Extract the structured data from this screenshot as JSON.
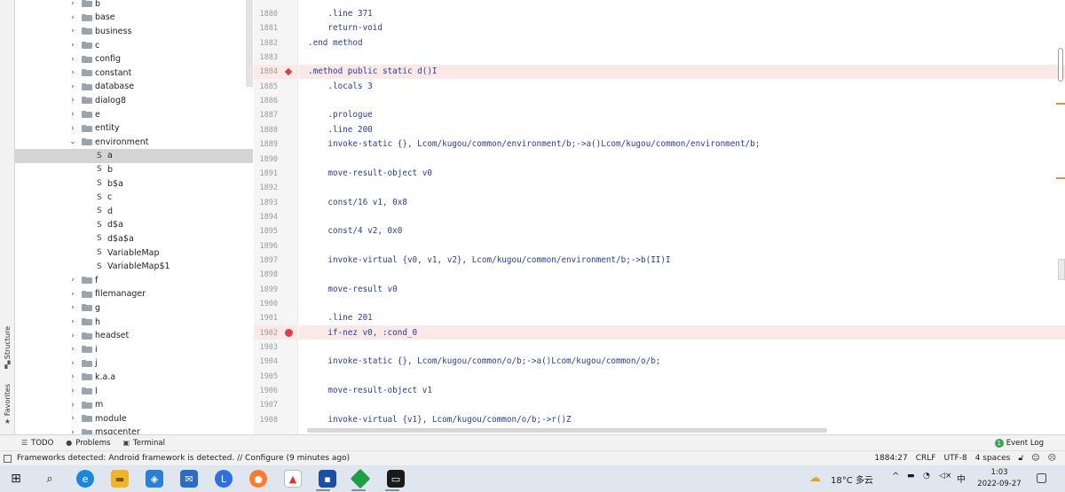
{
  "tool_strip": {
    "structure_label": "Structure",
    "favorites_label": "Favorites"
  },
  "tree": {
    "items": [
      {
        "type": "pkg",
        "label": "b",
        "expanded": false
      },
      {
        "type": "pkg",
        "label": "base",
        "expanded": false
      },
      {
        "type": "pkg",
        "label": "business",
        "expanded": false
      },
      {
        "type": "pkg",
        "label": "c",
        "expanded": false
      },
      {
        "type": "pkg",
        "label": "config",
        "expanded": false
      },
      {
        "type": "pkg",
        "label": "constant",
        "expanded": false
      },
      {
        "type": "pkg",
        "label": "database",
        "expanded": false
      },
      {
        "type": "pkg",
        "label": "dialog8",
        "expanded": false
      },
      {
        "type": "pkg",
        "label": "e",
        "expanded": false
      },
      {
        "type": "pkg",
        "label": "entity",
        "expanded": false
      },
      {
        "type": "pkg",
        "label": "environment",
        "expanded": true
      },
      {
        "type": "smali",
        "label": "a",
        "selected": true
      },
      {
        "type": "smali",
        "label": "b"
      },
      {
        "type": "smali",
        "label": "b$a"
      },
      {
        "type": "smali",
        "label": "c"
      },
      {
        "type": "smali",
        "label": "d"
      },
      {
        "type": "smali",
        "label": "d$a"
      },
      {
        "type": "smali",
        "label": "d$a$a"
      },
      {
        "type": "smali",
        "label": "VariableMap"
      },
      {
        "type": "smali",
        "label": "VariableMap$1"
      },
      {
        "type": "pkg",
        "label": "f",
        "expanded": false
      },
      {
        "type": "pkg",
        "label": "filemanager",
        "expanded": false
      },
      {
        "type": "pkg",
        "label": "g",
        "expanded": false
      },
      {
        "type": "pkg",
        "label": "h",
        "expanded": false
      },
      {
        "type": "pkg",
        "label": "headset",
        "expanded": false
      },
      {
        "type": "pkg",
        "label": "i",
        "expanded": false
      },
      {
        "type": "pkg",
        "label": "j",
        "expanded": false
      },
      {
        "type": "pkg",
        "label": "k.a.a",
        "expanded": false
      },
      {
        "type": "pkg",
        "label": "l",
        "expanded": false
      },
      {
        "type": "pkg",
        "label": "m",
        "expanded": false
      },
      {
        "type": "pkg",
        "label": "module",
        "expanded": false
      },
      {
        "type": "pkg",
        "label": "msgcenter",
        "expanded": false
      }
    ],
    "smali_icon_text": "S"
  },
  "editor": {
    "lines": [
      {
        "n": "1880",
        "code": "    .line 371"
      },
      {
        "n": "1881",
        "code": "    return-void"
      },
      {
        "n": "1882",
        "code": ".end method"
      },
      {
        "n": "1883",
        "code": ""
      },
      {
        "n": "1884",
        "code": ".method public static d()I",
        "marker": "diamond",
        "highlight": true
      },
      {
        "n": "1885",
        "code": "    .locals 3"
      },
      {
        "n": "1886",
        "code": ""
      },
      {
        "n": "1887",
        "code": "    .prologue"
      },
      {
        "n": "1888",
        "code": "    .line 200"
      },
      {
        "n": "1889",
        "code": "    invoke-static {}, Lcom/kugou/common/environment/b;->a()Lcom/kugou/common/environment/b;"
      },
      {
        "n": "1890",
        "code": ""
      },
      {
        "n": "1891",
        "code": "    move-result-object v0"
      },
      {
        "n": "1892",
        "code": ""
      },
      {
        "n": "1893",
        "code": "    const/16 v1, 0x8"
      },
      {
        "n": "1894",
        "code": ""
      },
      {
        "n": "1895",
        "code": "    const/4 v2, 0x0"
      },
      {
        "n": "1896",
        "code": ""
      },
      {
        "n": "1897",
        "code": "    invoke-virtual {v0, v1, v2}, Lcom/kugou/common/environment/b;->b(II)I"
      },
      {
        "n": "1898",
        "code": ""
      },
      {
        "n": "1899",
        "code": "    move-result v0"
      },
      {
        "n": "1900",
        "code": ""
      },
      {
        "n": "1901",
        "code": "    .line 201"
      },
      {
        "n": "1902",
        "code": "    if-nez v0, :cond_0",
        "marker": "dot",
        "highlight": true
      },
      {
        "n": "1903",
        "code": ""
      },
      {
        "n": "1904",
        "code": "    invoke-static {}, Lcom/kugou/common/o/b;->a()Lcom/kugou/common/o/b;"
      },
      {
        "n": "1905",
        "code": ""
      },
      {
        "n": "1906",
        "code": "    move-result-object v1"
      },
      {
        "n": "1907",
        "code": ""
      },
      {
        "n": "1908",
        "code": "    invoke-virtual {v1}, Lcom/kugou/common/o/b;->r()Z"
      }
    ]
  },
  "bottom_tabs": {
    "todo": "TODO",
    "problems": "Problems",
    "terminal": "Terminal",
    "event_log": "Event Log"
  },
  "status_bar": {
    "message": "Frameworks detected: Android framework is detected. // Configure (9 minutes ago)",
    "position": "1884:27",
    "line_sep": "CRLF",
    "encoding": "UTF-8",
    "indent": "4 spaces"
  },
  "taskbar": {
    "weather": "18°C 多云",
    "ime": "中",
    "time": "1:03",
    "date": "2022-09-27"
  },
  "colors": {
    "highlight_line": "#fbe9e8",
    "breakpoint": "#d9414a",
    "keyword": "#2a3c9a",
    "number": "#1a54d6"
  }
}
